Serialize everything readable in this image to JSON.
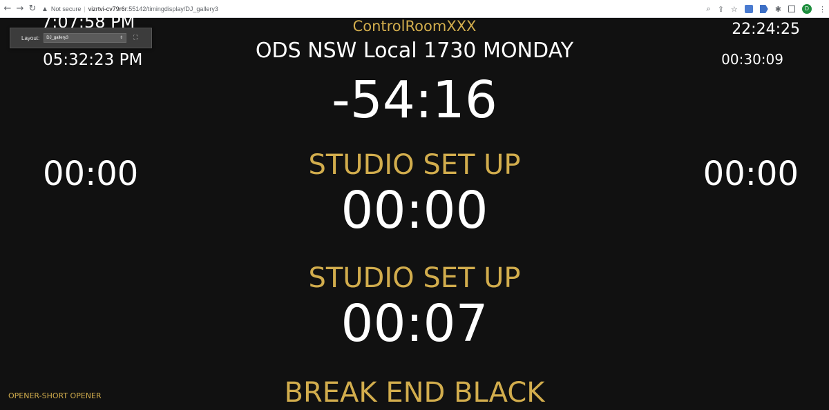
{
  "browser": {
    "not_secure": "Not secure",
    "separator": "|",
    "url_host": "vizrtvi-cv79r6r",
    "url_path": ":55142/timingdisplay/DJ_gallery3",
    "avatar_letter": "D"
  },
  "layout": {
    "label": "Layout:",
    "selected": "DJ_gallery3"
  },
  "clocks": {
    "left_top": "7:07:58 PM",
    "left_secondary": "05:32:23 PM",
    "right_top": "22:24:25",
    "right_secondary": "00:30:09"
  },
  "header": {
    "room": "ControlRoomXXX",
    "show": "ODS NSW Local 1730 MONDAY"
  },
  "main": {
    "countdown": "-54:16",
    "left_timer": "00:00",
    "right_timer": "00:00",
    "segment_1_title": "STUDIO SET UP",
    "segment_1_time": "00:00",
    "segment_2_title": "STUDIO SET UP",
    "segment_2_time": "00:07",
    "next_item": "BREAK END BLACK",
    "footer_left": "OPENER-SHORT OPENER"
  },
  "colors": {
    "background": "#111111",
    "accent_gold": "#d2ad4d",
    "text_white": "#ffffff"
  }
}
